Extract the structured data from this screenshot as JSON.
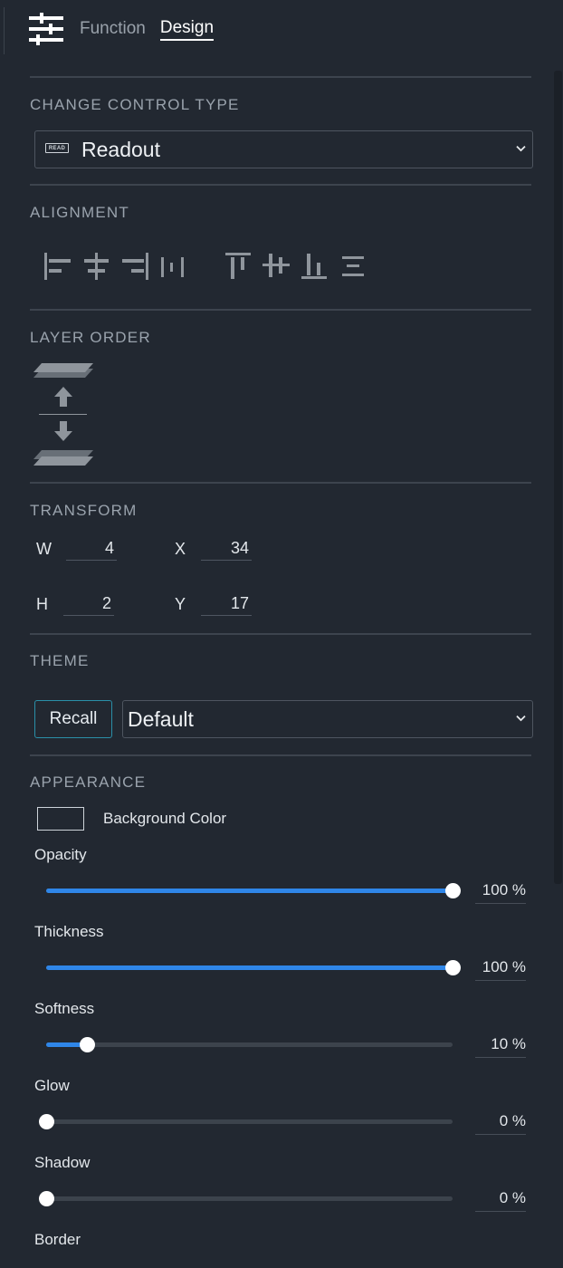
{
  "header": {
    "tabs": [
      {
        "label": "Function",
        "active": false
      },
      {
        "label": "Design",
        "active": true
      }
    ]
  },
  "control_type": {
    "title": "CHANGE CONTROL TYPE",
    "icon_text": "READ",
    "selected": "Readout"
  },
  "alignment": {
    "title": "ALIGNMENT",
    "buttons": [
      "align-left",
      "align-center-horizontal",
      "align-right",
      "distribute-horizontal",
      "align-top",
      "align-middle-vertical",
      "align-bottom",
      "distribute-vertical"
    ]
  },
  "layer_order": {
    "title": "LAYER ORDER",
    "buttons": [
      "bring-to-front",
      "move-forward",
      "move-backward",
      "send-to-back"
    ]
  },
  "transform": {
    "title": "TRANSFORM",
    "w_label": "W",
    "w_value": "4",
    "x_label": "X",
    "x_value": "34",
    "h_label": "H",
    "h_value": "2",
    "y_label": "Y",
    "y_value": "17"
  },
  "theme": {
    "title": "THEME",
    "recall_label": "Recall",
    "selected": "Default"
  },
  "appearance": {
    "title": "APPEARANCE",
    "background_color_label": "Background Color",
    "background_color": "#222831",
    "sliders": [
      {
        "label": "Opacity",
        "value": 100,
        "display": "100 %"
      },
      {
        "label": "Thickness",
        "value": 100,
        "display": "100 %"
      },
      {
        "label": "Softness",
        "value": 10,
        "display": "10 %"
      },
      {
        "label": "Glow",
        "value": 0,
        "display": "0 %"
      },
      {
        "label": "Shadow",
        "value": 0,
        "display": "0 %"
      }
    ],
    "border_label": "Border"
  },
  "colors": {
    "background": "#222831",
    "accent": "#2f86e8",
    "recall_border": "#2a8fa8",
    "icon_gray": "#8f959c"
  }
}
